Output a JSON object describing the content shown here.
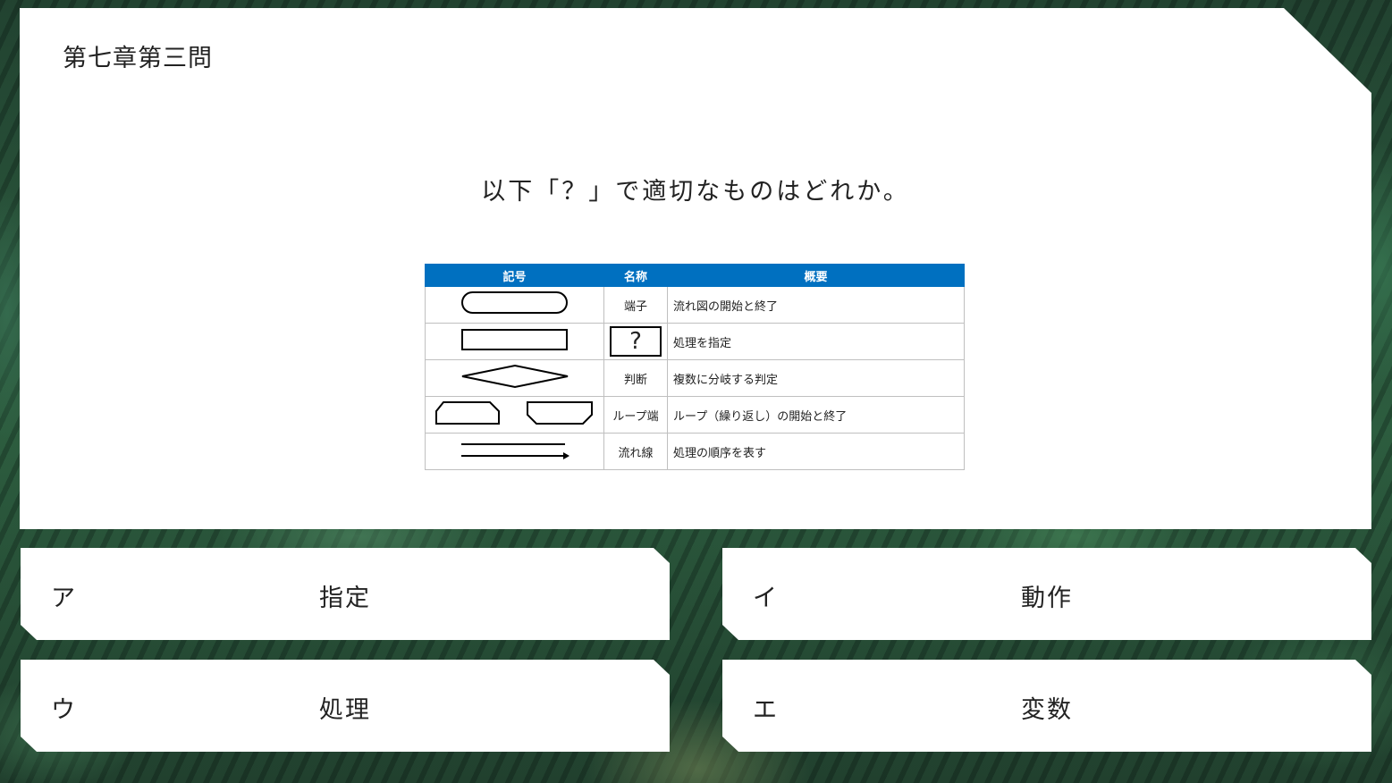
{
  "chapter_title": "第七章第三問",
  "question": "以下「？」で適切なものはどれか。",
  "table": {
    "headers": [
      "記号",
      "名称",
      "概要"
    ],
    "rows": [
      {
        "symbol": "terminal",
        "name": "端子",
        "desc": "流れ図の開始と終了"
      },
      {
        "symbol": "process",
        "name": "?",
        "desc": "処理を指定"
      },
      {
        "symbol": "decision",
        "name": "判断",
        "desc": "複数に分岐する判定"
      },
      {
        "symbol": "loop",
        "name": "ループ端",
        "desc": "ループ（繰り返し）の開始と終了"
      },
      {
        "symbol": "flowline",
        "name": "流れ線",
        "desc": "処理の順序を表す"
      }
    ],
    "header_color": "#0070c0"
  },
  "answers": [
    {
      "letter": "ア",
      "text": "指定"
    },
    {
      "letter": "イ",
      "text": "動作"
    },
    {
      "letter": "ウ",
      "text": "処理"
    },
    {
      "letter": "エ",
      "text": "変数"
    }
  ]
}
